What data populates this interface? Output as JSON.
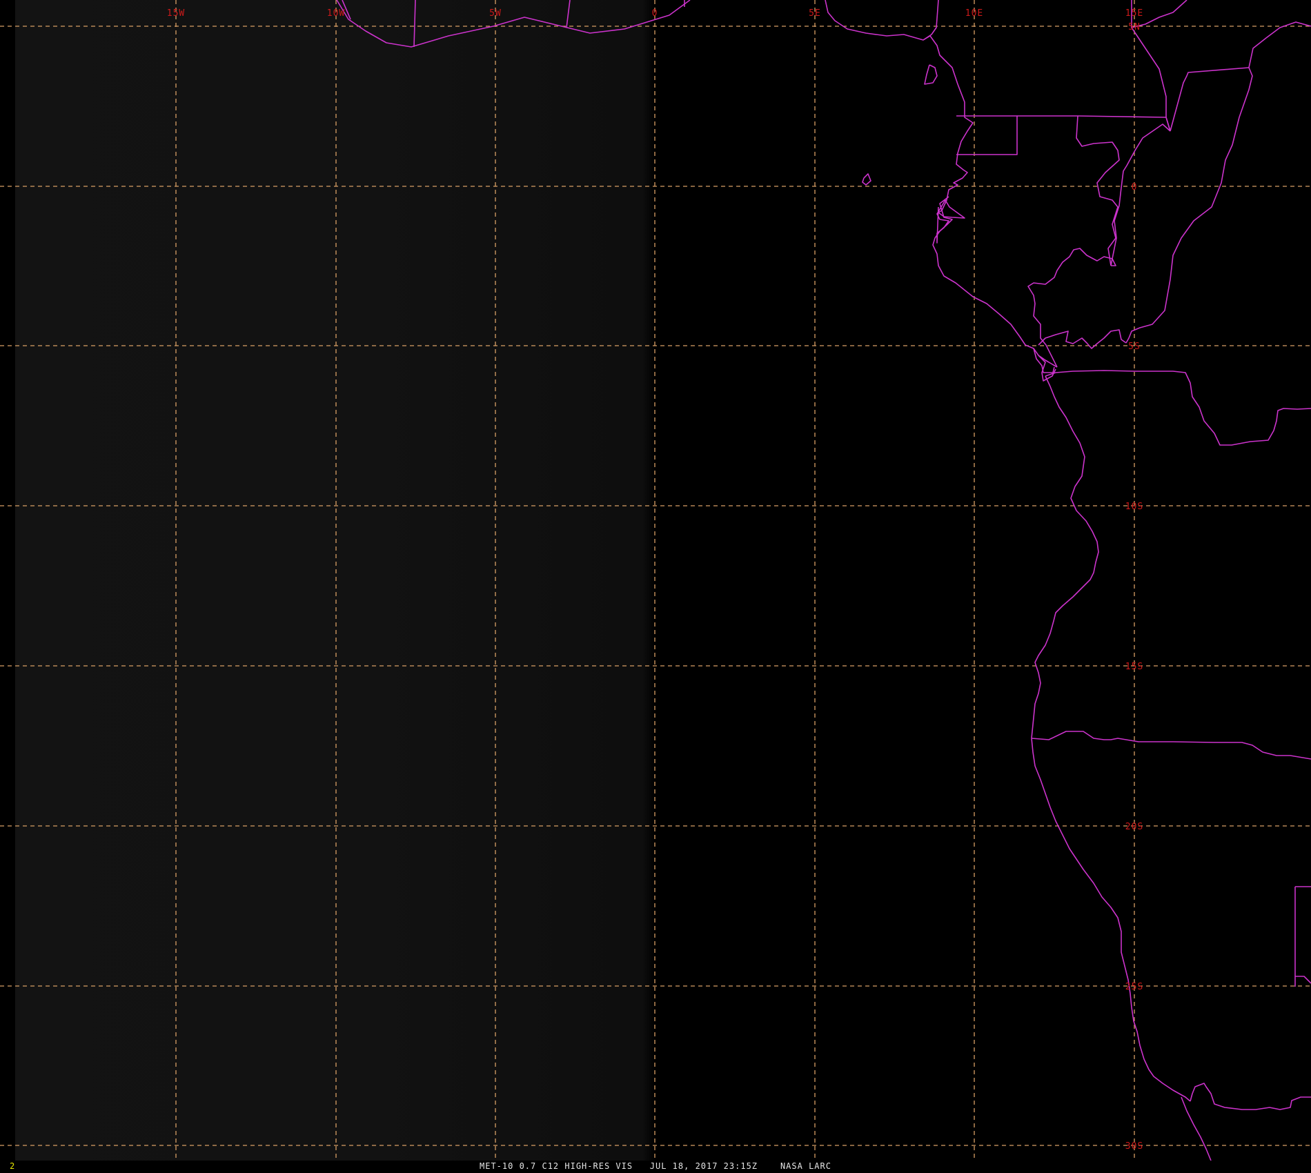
{
  "colors": {
    "background": "#000000",
    "ocean_shade": "#121212",
    "coastline": "#cc33cc",
    "gridline": "#d9a066",
    "grid_label": "#cc1a1a",
    "caption": "#e6e6e6",
    "frame_number": "#e8e800"
  },
  "lon_labels": [
    "15W",
    "10W",
    "5W",
    "0",
    "5E",
    "10E",
    "15E"
  ],
  "lat_labels": [
    "5N",
    "0",
    "5S",
    "10S",
    "15S",
    "20S",
    "25S",
    "30S"
  ],
  "frame_number": "2",
  "caption": {
    "sensor": "MET-10 0.7 C12 HIGH-RES VIS",
    "datetime": "JUL 18, 2017 23:15Z",
    "source": "NASA LARC"
  }
}
